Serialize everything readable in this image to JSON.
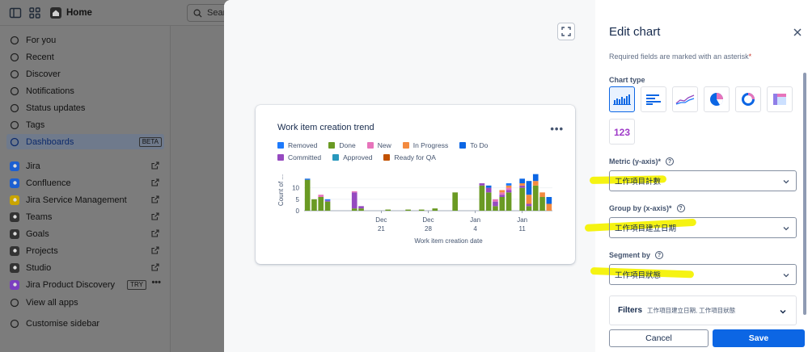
{
  "topbar": {
    "home_label": "Home",
    "search_placeholder": "Searc"
  },
  "sidebar": {
    "items": [
      {
        "label": "For you",
        "icon": "user-circle-icon"
      },
      {
        "label": "Recent",
        "icon": "clock-icon"
      },
      {
        "label": "Discover",
        "icon": "compass-icon"
      },
      {
        "label": "Notifications",
        "icon": "bell-icon"
      },
      {
        "label": "Status updates",
        "icon": "megaphone-icon"
      },
      {
        "label": "Tags",
        "icon": "hash-icon"
      },
      {
        "label": "Dashboards",
        "icon": "dashboard-icon",
        "badge": "BETA"
      },
      {
        "label": "Jira",
        "icon": "jira-icon"
      },
      {
        "label": "Confluence",
        "icon": "confluence-icon"
      },
      {
        "label": "Jira Service Management",
        "icon": "jsm-icon"
      },
      {
        "label": "Teams",
        "icon": "teams-icon"
      },
      {
        "label": "Goals",
        "icon": "goals-icon"
      },
      {
        "label": "Projects",
        "icon": "projects-icon"
      },
      {
        "label": "Studio",
        "icon": "studio-icon"
      },
      {
        "label": "Jira Product Discovery",
        "icon": "jpd-icon",
        "badge": "TRY"
      },
      {
        "label": "View all apps",
        "icon": "grid-icon"
      },
      {
        "label": "Customise sidebar",
        "icon": "sliders-icon"
      }
    ]
  },
  "preview": {
    "card_title": "Work item creation trend",
    "more": "•••"
  },
  "chart_data": {
    "type": "bar",
    "stacked": true,
    "ylabel": "Count of ...",
    "xlabel": "Work item creation date",
    "ylim": [
      0,
      18
    ],
    "yticks": [
      "0",
      "5",
      "10"
    ],
    "xticks": [
      {
        "index": 11,
        "line1": "Dec",
        "line2": "21"
      },
      {
        "index": 18,
        "line1": "Dec",
        "line2": "28"
      },
      {
        "index": 25,
        "line1": "Jan",
        "line2": "4"
      },
      {
        "index": 32,
        "line1": "Jan",
        "line2": "11"
      }
    ],
    "legend": [
      {
        "name": "Removed",
        "color": "#1d7afc"
      },
      {
        "name": "Done",
        "color": "#6a9a23"
      },
      {
        "name": "New",
        "color": "#e774bb"
      },
      {
        "name": "In Progress",
        "color": "#f38a3f"
      },
      {
        "name": "To Do",
        "color": "#0c66e4"
      },
      {
        "name": "Committed",
        "color": "#964ac0"
      },
      {
        "name": "Approved",
        "color": "#2898bd"
      },
      {
        "name": "Ready for QA",
        "color": "#c25100"
      }
    ],
    "num_days": 37,
    "bars": [
      {
        "d": 0,
        "s": {
          "Done": 13.5,
          "To Do": 0.5
        }
      },
      {
        "d": 1,
        "s": {
          "Done": 5
        }
      },
      {
        "d": 2,
        "s": {
          "Done": 6,
          "New": 1
        }
      },
      {
        "d": 3,
        "s": {
          "Done": 4,
          "Committed": 0.5,
          "Removed": 0.5
        }
      },
      {
        "d": 7,
        "s": {
          "Done": 1,
          "Committed": 7,
          "New": 0.5
        }
      },
      {
        "d": 8,
        "s": {
          "Done": 1,
          "Committed": 1
        }
      },
      {
        "d": 12,
        "s": {
          "Done": 0.5
        }
      },
      {
        "d": 15,
        "s": {
          "Done": 0.5
        }
      },
      {
        "d": 17,
        "s": {
          "Done": 0.5
        }
      },
      {
        "d": 19,
        "s": {
          "Done": 1
        }
      },
      {
        "d": 22,
        "s": {
          "Done": 8
        }
      },
      {
        "d": 26,
        "s": {
          "Done": 11,
          "Committed": 1
        }
      },
      {
        "d": 27,
        "s": {
          "Done": 8,
          "Committed": 2,
          "To Do": 1
        }
      },
      {
        "d": 28,
        "s": {
          "Done": 2,
          "Committed": 2,
          "New": 1
        }
      },
      {
        "d": 29,
        "s": {
          "Done": 6,
          "Committed": 1,
          "In Progress": 1,
          "New": 1
        }
      },
      {
        "d": 30,
        "s": {
          "Done": 8,
          "Committed": 1,
          "In Progress": 1,
          "New": 1,
          "Removed": 1
        }
      },
      {
        "d": 32,
        "s": {
          "Done": 10,
          "Committed": 1,
          "To Do": 2,
          "In Progress": 1
        }
      },
      {
        "d": 33,
        "s": {
          "In Progress": 4,
          "To Do": 6,
          "Done": 2,
          "Committed": 1
        }
      },
      {
        "d": 34,
        "s": {
          "Done": 11,
          "To Do": 3,
          "In Progress": 2
        }
      },
      {
        "d": 35,
        "s": {
          "Done": 6,
          "In Progress": 2
        }
      },
      {
        "d": 36,
        "s": {
          "In Progress": 3,
          "To Do": 3
        }
      }
    ]
  },
  "panel": {
    "title": "Edit chart",
    "required_note": "Required fields are marked with an asterisk",
    "asterisk": "*",
    "chart_type_label": "Chart type",
    "chart_types": [
      {
        "name": "vertical-bar",
        "selected": true
      },
      {
        "name": "horizontal-bar"
      },
      {
        "name": "line"
      },
      {
        "name": "pie"
      },
      {
        "name": "donut"
      },
      {
        "name": "table"
      },
      {
        "name": "number",
        "text": "123"
      }
    ],
    "metric_label": "Metric (y-axis)*",
    "metric_value": "工作項目計數",
    "group_label": "Group by (x-axis)*",
    "group_value": "工作項目建立日期",
    "segment_label": "Segment by",
    "segment_value": "工作項目狀態",
    "filters_label": "Filters",
    "filters_summary": "工作項目建立日期, 工作項目狀態",
    "cancel_label": "Cancel",
    "save_label": "Save",
    "highlight_color": "#f5f312"
  }
}
